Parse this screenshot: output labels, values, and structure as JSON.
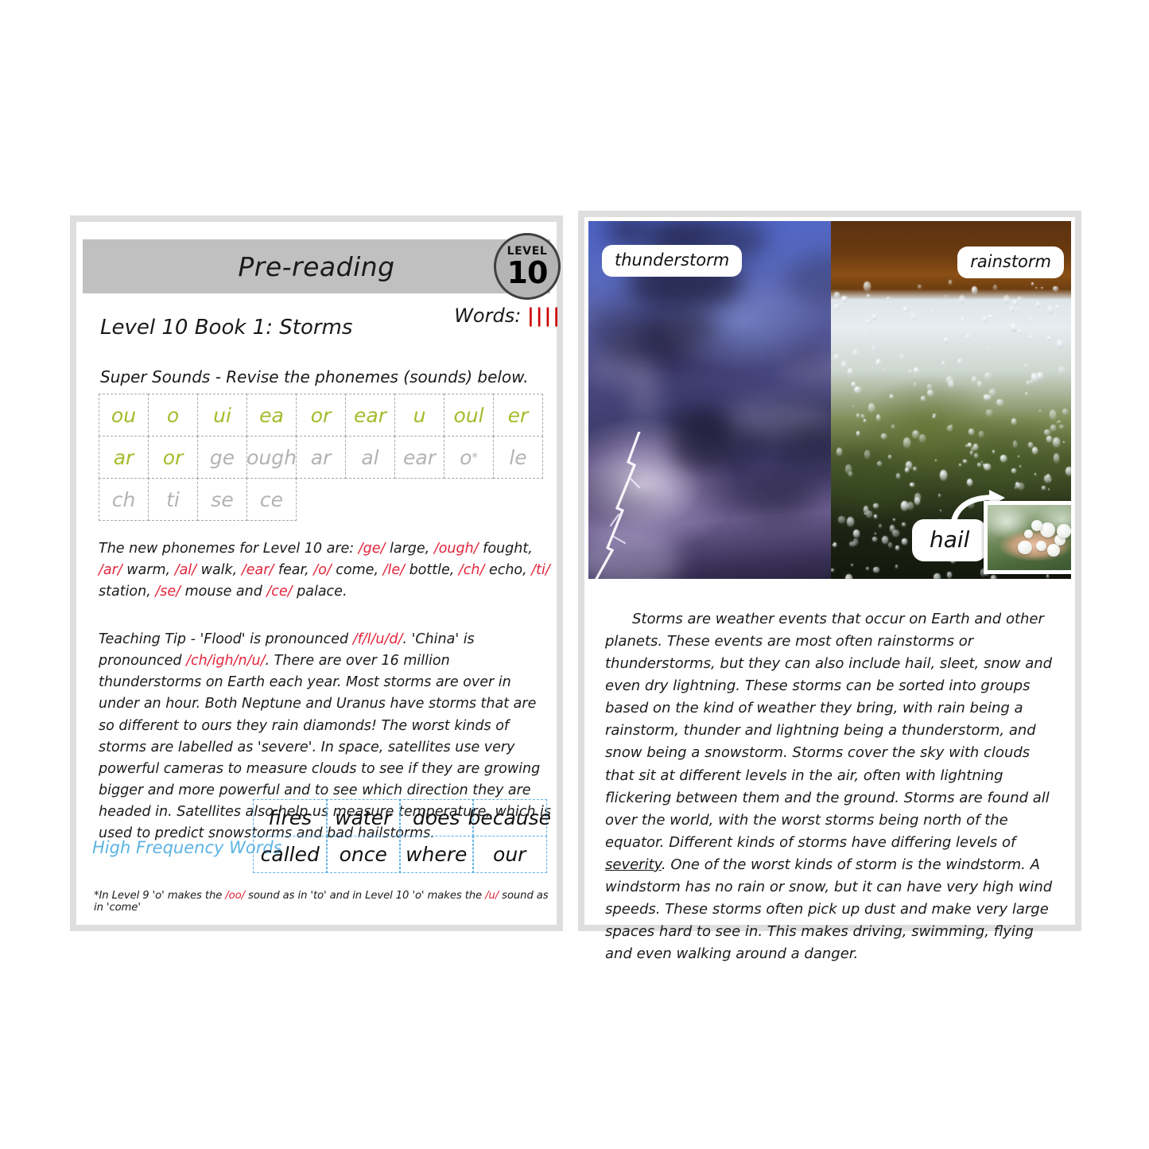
{
  "left_page": {
    "header_title": "Pre-reading",
    "level_badge": {
      "word": "LEVEL",
      "number": "10"
    },
    "words_label": "Words:",
    "words_tally": "||||",
    "book_title": "Level 10 Book 1: Storms",
    "super_sounds_heading": "Super Sounds - Revise the phonemes (sounds) below.",
    "phoneme_grid": {
      "rows": [
        [
          {
            "text": "ou",
            "color": "green"
          },
          {
            "text": "o",
            "color": "green"
          },
          {
            "text": "ui",
            "color": "green"
          },
          {
            "text": "ea",
            "color": "green"
          },
          {
            "text": "or",
            "color": "green"
          },
          {
            "text": "ear",
            "color": "green"
          },
          {
            "text": "u",
            "color": "green"
          },
          {
            "text": "oul",
            "color": "green"
          },
          {
            "text": "er",
            "color": "green"
          }
        ],
        [
          {
            "text": "ar",
            "color": "green"
          },
          {
            "text": "or",
            "color": "green"
          },
          {
            "text": "ge",
            "color": "gray"
          },
          {
            "text": "ough",
            "color": "gray"
          },
          {
            "text": "ar",
            "color": "gray"
          },
          {
            "text": "al",
            "color": "gray"
          },
          {
            "text": "ear",
            "color": "gray"
          },
          {
            "text": "o*",
            "color": "gray"
          },
          {
            "text": "le",
            "color": "gray"
          }
        ],
        [
          {
            "text": "ch",
            "color": "gray"
          },
          {
            "text": "ti",
            "color": "gray"
          },
          {
            "text": "se",
            "color": "gray"
          },
          {
            "text": "ce",
            "color": "gray"
          }
        ]
      ]
    },
    "new_phonemes_paragraph": "The new phonemes for Level 10 are: /ge/ large, /ough/ fought, /ar/ warm, /al/ walk, /ear/ fear, /o/ come, /le/ bottle, /ch/ echo, /ti/ station, /se/ mouse and /ce/ palace.",
    "new_phonemes_parts": [
      {
        "t": "The new phonemes for Level 10 are: ",
        "c": "black"
      },
      {
        "t": "/ge/",
        "c": "red"
      },
      {
        "t": " large, ",
        "c": "black"
      },
      {
        "t": "/ough/",
        "c": "red"
      },
      {
        "t": " fought, ",
        "c": "black"
      },
      {
        "t": "/ar/",
        "c": "red"
      },
      {
        "t": " warm, ",
        "c": "black"
      },
      {
        "t": "/al/",
        "c": "red"
      },
      {
        "t": " walk, ",
        "c": "black"
      },
      {
        "t": "/ear/",
        "c": "red"
      },
      {
        "t": " fear, ",
        "c": "black"
      },
      {
        "t": "/o/",
        "c": "red"
      },
      {
        "t": " come, ",
        "c": "black"
      },
      {
        "t": "/le/",
        "c": "red"
      },
      {
        "t": " bottle, ",
        "c": "black"
      },
      {
        "t": "/ch/",
        "c": "red"
      },
      {
        "t": " echo, ",
        "c": "black"
      },
      {
        "t": "/ti/",
        "c": "red"
      },
      {
        "t": " station, ",
        "c": "black"
      },
      {
        "t": "/se/",
        "c": "red"
      },
      {
        "t": " mouse and ",
        "c": "black"
      },
      {
        "t": "/ce/",
        "c": "red"
      },
      {
        "t": " palace.",
        "c": "black"
      }
    ],
    "teaching_tip_parts": [
      {
        "t": "Teaching Tip - 'Flood' is pronounced ",
        "c": "black"
      },
      {
        "t": "/f/l/u/d/",
        "c": "red"
      },
      {
        "t": ". 'China' is pronounced ",
        "c": "black"
      },
      {
        "t": "/ch/igh/n/u/",
        "c": "red"
      },
      {
        "t": ". There are over 16 million thunderstorms on Earth each year. Most storms are over in under an hour. Both Neptune and Uranus have storms that are so different to ours they rain diamonds! The worst kinds of storms are labelled as 'severe'. In space, satellites use very powerful cameras to measure clouds to see if they are growing bigger and more powerful and to see which direction they are headed in. Satellites also help us measure temperature, which is used to predict snowstorms and bad hailstorms.",
        "c": "black"
      }
    ],
    "hfw_label": "High Frequency Words",
    "hfw_rows": [
      [
        "fires",
        "water",
        "does",
        "because"
      ],
      [
        "called",
        "once",
        "where",
        "our"
      ]
    ],
    "footnote_parts": [
      {
        "t": "*In Level 9 'o' makes the ",
        "c": "black"
      },
      {
        "t": "/oo/",
        "c": "red"
      },
      {
        "t": " sound as in 'to' and in Level 10 'o' makes the ",
        "c": "black"
      },
      {
        "t": "/u/",
        "c": "red"
      },
      {
        "t": " sound as in 'come'",
        "c": "black"
      }
    ]
  },
  "right_page": {
    "photo_labels": {
      "thunderstorm": "thunderstorm",
      "rainstorm": "rainstorm",
      "hail": "hail"
    },
    "body_text_parts": [
      {
        "t": "Storms are weather events that occur on Earth and other planets. These events are most often rainstorms or thunderstorms, but they can also include hail, sleet, snow and even dry lightning. These storms can be sorted into groups based on the kind of weather they bring, with rain being a rainstorm, thunder and lightning being a thunderstorm, and snow being a snowstorm. Storms cover the sky with clouds that sit at different levels in the air, often with lightning flickering between them and the ground. Storms are found all over the world, with the worst storms being north of the equator. Different kinds of storms have differing levels of ",
        "style": "normal"
      },
      {
        "t": "severity",
        "style": "underline"
      },
      {
        "t": ". One of the worst kinds of storm is the windstorm. A windstorm has no rain or snow, but it can have very high wind speeds. These storms often pick up dust and make very large spaces hard to see in. This makes driving, swimming, flying and even walking around a danger.",
        "style": "normal"
      }
    ]
  },
  "colors": {
    "green_phoneme": "#a6bb2c",
    "gray_phoneme": "#b3b3b3",
    "red_accent": "#e2243b",
    "blue_hfw": "#5cb3e4",
    "header_band": "#c0c0c0",
    "page_border": "#dededf"
  }
}
